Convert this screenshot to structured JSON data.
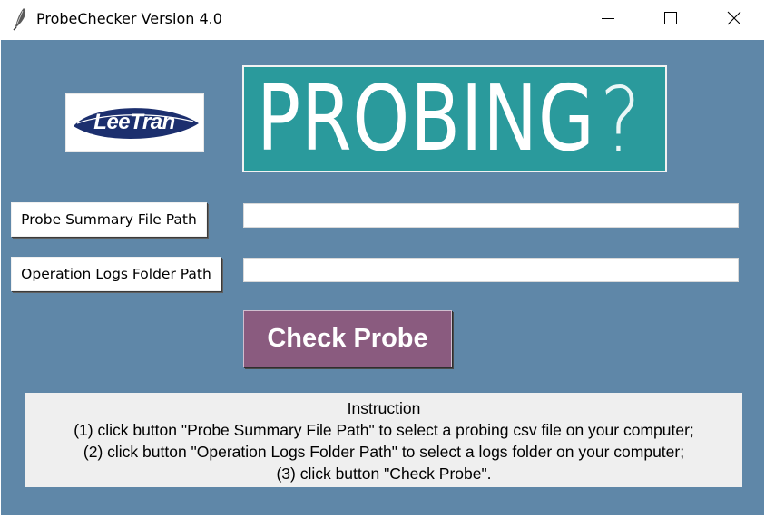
{
  "window": {
    "title": "ProbeChecker Version 4.0",
    "icon": "feather-icon",
    "controls": [
      "minimize-icon",
      "maximize-icon",
      "close-icon"
    ]
  },
  "logo": {
    "text": "LeeTran"
  },
  "banner": {
    "text": "PROBING",
    "symbol": "?"
  },
  "probe_summary": {
    "button_label": "Probe Summary File Path",
    "path_value": ""
  },
  "operation_logs": {
    "button_label": "Operation Logs Folder Path",
    "path_value": ""
  },
  "check_button": {
    "label": "Check Probe"
  },
  "instructions": {
    "heading": "Instruction",
    "lines": [
      "(1) click button \"Probe Summary File Path\" to select a probing csv file on your computer;",
      "(2) click button \"Operation Logs Folder Path\" to select a logs folder on your computer;",
      "(3) click button \"Check Probe\"."
    ]
  },
  "colors": {
    "background": "#5f87a8",
    "banner": "#2a9a9c",
    "check_button": "#8a5b7f",
    "instruction_panel": "#efefef",
    "logo_navy": "#1c2f6e"
  }
}
